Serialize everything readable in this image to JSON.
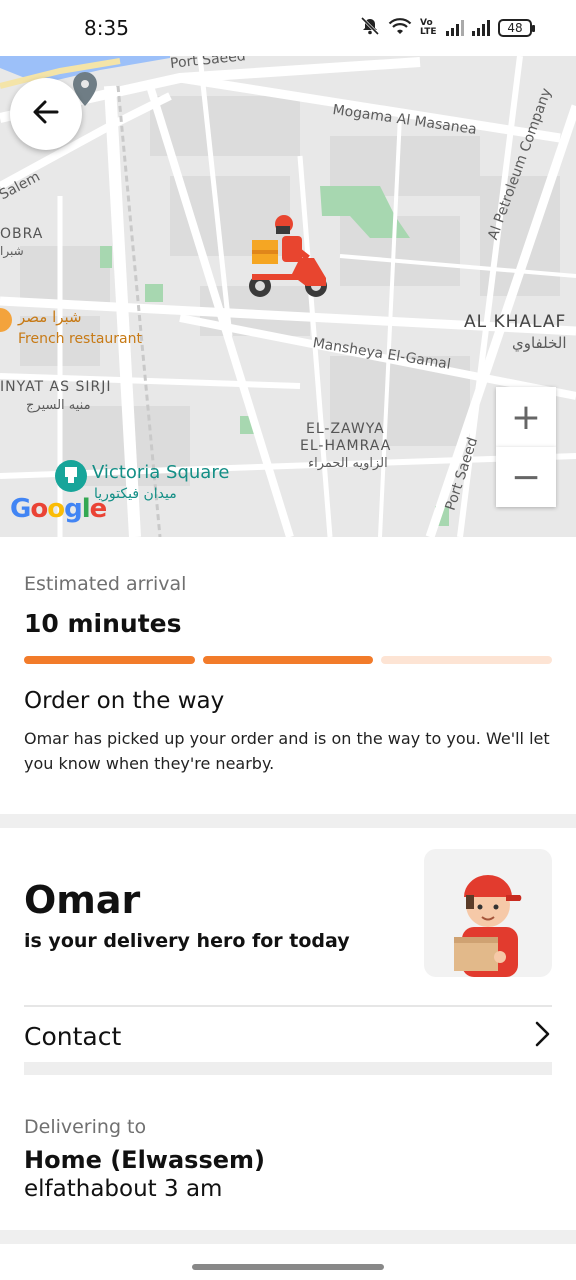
{
  "status_bar": {
    "time": "8:35",
    "network_label": "Vo LTE",
    "battery": "48",
    "icons": [
      "bell-off-icon",
      "wifi-icon",
      "signal-icon",
      "signal-icon",
      "battery-icon"
    ]
  },
  "map": {
    "labels": {
      "port_saeed_top": "Port Saeed",
      "mogama": "Mogama Al Masanea",
      "petroleum": "Al Petroleum Company",
      "salem": "Salem",
      "shobra": "OBRA",
      "shobra_ar": "شبرا",
      "shobra_misr_ar": "شبرا مصر",
      "french_restaurant": "French restaurant",
      "al_khalafawy": "AL KHALAF",
      "al_khalafawy_ar": "الخلفاوي",
      "mansheya": "Mansheya El-Gamal",
      "minyat": "INYAT AS SIRJI",
      "minyat_ar": "منيه السيرج",
      "zawya_1": "EL-ZAWYA",
      "zawya_2": "EL-HAMRAA",
      "zawya_ar": "الزاويه الحمراء",
      "victoria": "Victoria Square",
      "victoria_ar": "ميدان فيكتوريا",
      "port_saeed_bottom": "Port Saeed",
      "google": "Google"
    },
    "zoom_in": "+",
    "zoom_out": "−"
  },
  "eta": {
    "label": "Estimated arrival",
    "value": "10 minutes",
    "progress_steps_done": 2,
    "progress_steps_total": 3,
    "status_title": "Order on the way",
    "status_desc": "Omar has picked up your order and is on the way to you. We'll let you know when they're nearby."
  },
  "hero": {
    "name": "Omar",
    "subtitle": "is your delivery hero for today"
  },
  "contact": {
    "label": "Contact"
  },
  "delivery": {
    "label": "Delivering to",
    "place": "Home (Elwassem)",
    "address": "elfathabout 3 am"
  },
  "colors": {
    "accent": "#f27b2a",
    "accent_light": "#fde4d4",
    "map_bg": "#ebebeb",
    "park": "#a7d7b0",
    "water": "#9cc0f9"
  }
}
